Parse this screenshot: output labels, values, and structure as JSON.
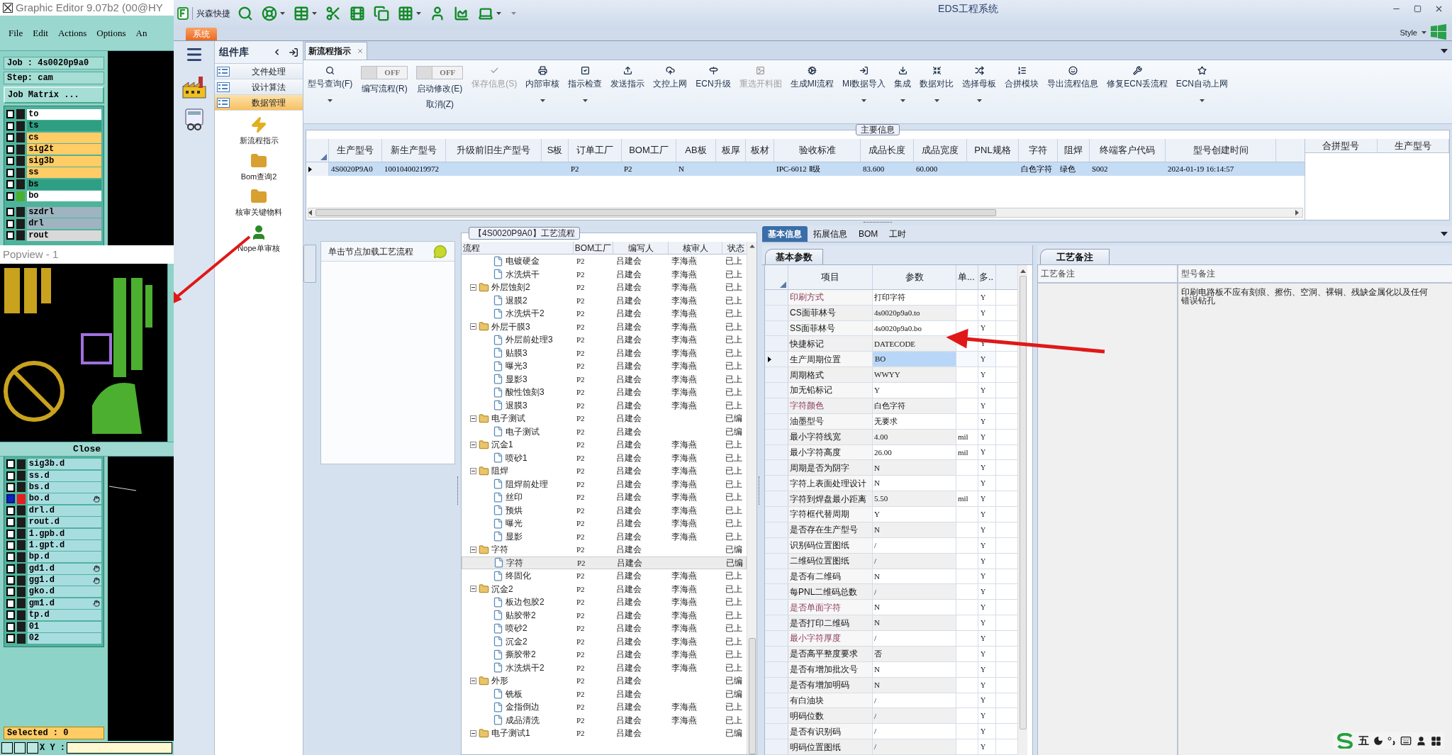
{
  "editor": {
    "title": "Graphic Editor 9.07b2 (00@HY",
    "menu": [
      "File",
      "Edit",
      "Actions",
      "Options",
      "An"
    ],
    "job": "Job : 4s0020p9a0",
    "step": "Step: cam",
    "matrix_button": "Job Matrix ...",
    "layer_groups": [
      {
        "layers": [
          {
            "name": "to",
            "color": "#ffffff",
            "shown": false,
            "checked": false
          },
          {
            "name": "ts",
            "color": "#2f9f83",
            "shown": false,
            "checked": false
          },
          {
            "name": "cs",
            "color": "#ffcc66",
            "shown": false,
            "checked": false
          },
          {
            "name": "sig2t",
            "color": "#ffcc66",
            "shown": false,
            "checked": false
          },
          {
            "name": "sig3b",
            "color": "#ffcc66",
            "shown": false,
            "checked": false
          },
          {
            "name": "ss",
            "color": "#ffcc66",
            "shown": false,
            "checked": false
          },
          {
            "name": "bs",
            "color": "#2f9f83",
            "shown": false,
            "checked": false
          },
          {
            "name": "bo",
            "color": "#ffffff",
            "shown": true,
            "checked": false
          }
        ]
      },
      {
        "layers": [
          {
            "name": "szdrl",
            "color": "#9fb4c0",
            "shown": false,
            "checked": false
          },
          {
            "name": "drl",
            "color": "#9fb4c0",
            "shown": false,
            "checked": false
          },
          {
            "name": "rout",
            "color": "#d9d9d9",
            "shown": false,
            "checked": false
          }
        ]
      }
    ],
    "popview": {
      "title": "Popview - 1",
      "close": "Close"
    },
    "lower_layers": [
      {
        "name": "sig3b.d",
        "work": false,
        "hand": false
      },
      {
        "name": "ss.d",
        "work": false,
        "hand": false
      },
      {
        "name": "bs.d",
        "work": false,
        "hand": false
      },
      {
        "name": "bo.d",
        "work": true,
        "hand": true
      },
      {
        "name": "drl.d",
        "work": false,
        "hand": false
      },
      {
        "name": "rout.d",
        "work": false,
        "hand": false
      },
      {
        "name": "1.gpb.d",
        "work": false,
        "hand": false
      },
      {
        "name": "1.gpt.d",
        "work": false,
        "hand": false
      },
      {
        "name": "bp.d",
        "work": false,
        "hand": false
      },
      {
        "name": "gd1.d",
        "work": false,
        "hand": true
      },
      {
        "name": "gg1.d",
        "work": false,
        "hand": true
      },
      {
        "name": "gko.d",
        "work": false,
        "hand": false
      },
      {
        "name": "gm1.d",
        "work": false,
        "hand": true
      },
      {
        "name": "tp.d",
        "work": false,
        "hand": false
      },
      {
        "name": "01",
        "work": false,
        "hand": false
      },
      {
        "name": "02",
        "work": false,
        "hand": false
      }
    ],
    "selected": "Selected : 0",
    "coords": "X Y :"
  },
  "app": {
    "quick_label": "兴森快捷",
    "title": "EDS工程系统",
    "menu_tab": "系统",
    "style": "Style"
  },
  "components": {
    "title": "组件库",
    "groups": [
      {
        "label": "文件处理",
        "selected": false
      },
      {
        "label": "设计算法",
        "selected": false
      },
      {
        "label": "数据管理",
        "selected": true
      }
    ],
    "tools": [
      "新流程指示",
      "Bom查询2",
      "核审关键物料",
      "Nope单审核"
    ]
  },
  "document_tab": {
    "label": "新流程指示"
  },
  "ribbon": {
    "items": [
      {
        "kind": "button",
        "label": "型号查询(F)",
        "dropdown": true,
        "disabled": false
      },
      {
        "kind": "toggle",
        "state_label": "OFF",
        "on": false,
        "labels": [
          "编写流程(R)"
        ]
      },
      {
        "kind": "toggle",
        "state_label": "OFF",
        "on": false,
        "labels": [
          "启动修改(E)",
          "取消(Z)"
        ]
      },
      {
        "kind": "button",
        "label": "保存信息(S)",
        "dropdown": false,
        "disabled": true
      },
      {
        "kind": "button",
        "label": "内部审核",
        "dropdown": true,
        "disabled": false
      },
      {
        "kind": "button",
        "label": "指示检查",
        "dropdown": true,
        "disabled": false
      },
      {
        "kind": "button",
        "label": "发送指示",
        "dropdown": false,
        "disabled": false
      },
      {
        "kind": "button",
        "label": "文控上网",
        "dropdown": false,
        "disabled": false
      },
      {
        "kind": "button",
        "label": "ECN升级",
        "dropdown": false,
        "disabled": false
      },
      {
        "kind": "button",
        "label": "重选开料图",
        "dropdown": false,
        "disabled": true
      },
      {
        "kind": "button",
        "label": "生成MI流程",
        "dropdown": false,
        "disabled": false
      },
      {
        "kind": "button",
        "label": "MI数据导入",
        "dropdown": true,
        "disabled": false
      },
      {
        "kind": "button",
        "label": "集成",
        "dropdown": true,
        "disabled": false
      },
      {
        "kind": "button",
        "label": "数据对比",
        "dropdown": true,
        "disabled": false
      },
      {
        "kind": "button",
        "label": "选择母板",
        "dropdown": true,
        "disabled": false
      },
      {
        "kind": "button",
        "label": "合拼模块",
        "dropdown": false,
        "disabled": false
      },
      {
        "kind": "button",
        "label": "导出流程信息",
        "dropdown": false,
        "disabled": false
      },
      {
        "kind": "button",
        "label": "修复ECN丢流程",
        "dropdown": false,
        "disabled": false
      },
      {
        "kind": "button",
        "label": "ECN自动上网",
        "dropdown": true,
        "disabled": false
      }
    ]
  },
  "main_info": {
    "legend": "主要信息",
    "columns": [
      "生产型号",
      "新生产型号",
      "升级前旧生产型号",
      "S板",
      "订单工厂",
      "BOM工厂",
      "AB板",
      "板厚",
      "板材",
      "验收标准",
      "成品长度",
      "成品宽度",
      "PNL规格",
      "字符",
      "阻焊",
      "终端客户代码",
      "型号创建时间"
    ],
    "rows": [
      {
        "selected": true,
        "cells": [
          "4S0020P9A0",
          "10010400219972",
          null,
          null,
          "P2",
          "P2",
          "N",
          null,
          null,
          "IPC-6012 Ⅱ级",
          "83.600",
          "60.000",
          null,
          "白色字符",
          "绿色",
          "S002",
          "2024-01-19 16:14:57"
        ]
      }
    ],
    "side_columns": [
      "合拼型号",
      "生产型号"
    ]
  },
  "process": {
    "hint": "单击节点加载工艺流程",
    "legend": "【4S0020P9A0】工艺流程",
    "columns": [
      "流程",
      "BOM工厂",
      "编写人",
      "核审人",
      "状态"
    ],
    "items": [
      {
        "kind": "continued",
        "children": [
          {
            "kind": "file",
            "name": "电镀硬金",
            "bom": "P2",
            "writer": "吕建会",
            "reviewer": "李海燕",
            "status": "已上",
            "selected": false
          },
          {
            "kind": "file",
            "name": "水洗烘干",
            "bom": "P2",
            "writer": "吕建会",
            "reviewer": "李海燕",
            "status": "已上",
            "selected": false
          }
        ]
      },
      {
        "kind": "folder",
        "name": "外层蚀刻2",
        "bom": "P2",
        "writer": "吕建会",
        "reviewer": "李海燕",
        "status": "已上",
        "selected": false,
        "expanded": true,
        "children": [
          {
            "kind": "file",
            "name": "退膜2",
            "bom": "P2",
            "writer": "吕建会",
            "reviewer": "李海燕",
            "status": "已上",
            "selected": false
          },
          {
            "kind": "file",
            "name": "水洗烘干2",
            "bom": "P2",
            "writer": "吕建会",
            "reviewer": "李海燕",
            "status": "已上",
            "selected": false
          }
        ]
      },
      {
        "kind": "folder",
        "name": "外层干膜3",
        "bom": "P2",
        "writer": "吕建会",
        "reviewer": "李海燕",
        "status": "已上",
        "selected": false,
        "expanded": true,
        "children": [
          {
            "kind": "file",
            "name": "外层前处理3",
            "bom": "P2",
            "writer": "吕建会",
            "reviewer": "李海燕",
            "status": "已上",
            "selected": false
          },
          {
            "kind": "file",
            "name": "贴膜3",
            "bom": "P2",
            "writer": "吕建会",
            "reviewer": "李海燕",
            "status": "已上",
            "selected": false
          },
          {
            "kind": "file",
            "name": "曝光3",
            "bom": "P2",
            "writer": "吕建会",
            "reviewer": "李海燕",
            "status": "已上",
            "selected": false
          },
          {
            "kind": "file",
            "name": "显影3",
            "bom": "P2",
            "writer": "吕建会",
            "reviewer": "李海燕",
            "status": "已上",
            "selected": false
          },
          {
            "kind": "file",
            "name": "酸性蚀刻3",
            "bom": "P2",
            "writer": "吕建会",
            "reviewer": "李海燕",
            "status": "已上",
            "selected": false
          },
          {
            "kind": "file",
            "name": "退膜3",
            "bom": "P2",
            "writer": "吕建会",
            "reviewer": "李海燕",
            "status": "已上",
            "selected": false
          }
        ]
      },
      {
        "kind": "folder",
        "name": "电子测试",
        "bom": "P2",
        "writer": "吕建会",
        "status": "已编",
        "selected": false,
        "expanded": true,
        "children": [
          {
            "kind": "file",
            "name": "电子测试",
            "bom": "P2",
            "writer": "吕建会",
            "status": "已编",
            "selected": false
          }
        ]
      },
      {
        "kind": "folder",
        "name": "沉金1",
        "bom": "P2",
        "writer": "吕建会",
        "reviewer": "李海燕",
        "status": "已上",
        "selected": false,
        "expanded": true,
        "children": [
          {
            "kind": "file",
            "name": "喷砂1",
            "bom": "P2",
            "writer": "吕建会",
            "reviewer": "李海燕",
            "status": "已上",
            "selected": false
          }
        ]
      },
      {
        "kind": "folder",
        "name": "阻焊",
        "bom": "P2",
        "writer": "吕建会",
        "reviewer": "李海燕",
        "status": "已上",
        "selected": false,
        "expanded": true,
        "children": [
          {
            "kind": "file",
            "name": "阻焊前处理",
            "bom": "P2",
            "writer": "吕建会",
            "reviewer": "李海燕",
            "status": "已上",
            "selected": false
          },
          {
            "kind": "file",
            "name": "丝印",
            "bom": "P2",
            "writer": "吕建会",
            "reviewer": "李海燕",
            "status": "已上",
            "selected": false
          },
          {
            "kind": "file",
            "name": "预烘",
            "bom": "P2",
            "writer": "吕建会",
            "reviewer": "李海燕",
            "status": "已上",
            "selected": false
          },
          {
            "kind": "file",
            "name": "曝光",
            "bom": "P2",
            "writer": "吕建会",
            "reviewer": "李海燕",
            "status": "已上",
            "selected": false
          },
          {
            "kind": "file",
            "name": "显影",
            "bom": "P2",
            "writer": "吕建会",
            "reviewer": "李海燕",
            "status": "已上",
            "selected": false
          }
        ]
      },
      {
        "kind": "folder",
        "name": "字符",
        "bom": "P2",
        "writer": "吕建会",
        "status": "已编",
        "selected": false,
        "expanded": true,
        "children": [
          {
            "kind": "file",
            "name": "字符",
            "bom": "P2",
            "writer": "吕建会",
            "status": "已编",
            "selected": true
          },
          {
            "kind": "file",
            "name": "终固化",
            "bom": "P2",
            "writer": "吕建会",
            "reviewer": "李海燕",
            "status": "已上",
            "selected": false
          }
        ]
      },
      {
        "kind": "folder",
        "name": "沉金2",
        "bom": "P2",
        "writer": "吕建会",
        "reviewer": "李海燕",
        "status": "已上",
        "selected": false,
        "expanded": true,
        "children": [
          {
            "kind": "file",
            "name": "板边包胶2",
            "bom": "P2",
            "writer": "吕建会",
            "reviewer": "李海燕",
            "status": "已上",
            "selected": false
          },
          {
            "kind": "file",
            "name": "贴胶带2",
            "bom": "P2",
            "writer": "吕建会",
            "reviewer": "李海燕",
            "status": "已上",
            "selected": false
          },
          {
            "kind": "file",
            "name": "喷砂2",
            "bom": "P2",
            "writer": "吕建会",
            "reviewer": "李海燕",
            "status": "已上",
            "selected": false
          },
          {
            "kind": "file",
            "name": "沉金2",
            "bom": "P2",
            "writer": "吕建会",
            "reviewer": "李海燕",
            "status": "已上",
            "selected": false
          },
          {
            "kind": "file",
            "name": "撕胶带2",
            "bom": "P2",
            "writer": "吕建会",
            "reviewer": "李海燕",
            "status": "已上",
            "selected": false
          },
          {
            "kind": "file",
            "name": "水洗烘干2",
            "bom": "P2",
            "writer": "吕建会",
            "reviewer": "李海燕",
            "status": "已上",
            "selected": false
          }
        ]
      },
      {
        "kind": "folder",
        "name": "外形",
        "bom": "P2",
        "writer": "吕建会",
        "status": "已编",
        "selected": false,
        "expanded": true,
        "children": [
          {
            "kind": "file",
            "name": "铣板",
            "bom": "P2",
            "writer": "吕建会",
            "status": "已编",
            "selected": false
          },
          {
            "kind": "file",
            "name": "金指倒边",
            "bom": "P2",
            "writer": "吕建会",
            "reviewer": "李海燕",
            "status": "已上",
            "selected": false
          },
          {
            "kind": "file",
            "name": "成品清洗",
            "bom": "P2",
            "writer": "吕建会",
            "reviewer": "李海燕",
            "status": "已上",
            "selected": false
          }
        ]
      },
      {
        "kind": "folder",
        "name": "电子测试1",
        "bom": "P2",
        "writer": "吕建会",
        "status": "已编",
        "selected": false,
        "expanded": true
      }
    ]
  },
  "detail": {
    "tabs": [
      {
        "label": "基本信息",
        "selected": true
      },
      {
        "label": "拓展信息",
        "selected": false
      },
      {
        "label": "BOM",
        "selected": false
      },
      {
        "label": "工时",
        "selected": false
      }
    ],
    "params": {
      "tab": "基本参数",
      "columns": [
        "项目",
        "参数",
        "单...",
        "多.."
      ],
      "rows": [
        {
          "item": "印刷方式",
          "value": "打印字符",
          "flag": "Y",
          "emphasized": true,
          "selected": false
        },
        {
          "item": "CS面菲林号",
          "value": "4s0020p9a0.to",
          "flag": "Y",
          "emphasized": false,
          "selected": false
        },
        {
          "item": "SS面菲林号",
          "value": "4s0020p9a0.bo",
          "flag": "Y",
          "emphasized": false,
          "selected": false
        },
        {
          "item": "快捷标记",
          "value": "DATECODE",
          "flag": "Y",
          "emphasized": false,
          "selected": false
        },
        {
          "item": "生产周期位置",
          "value": "BO",
          "flag": "Y",
          "emphasized": false,
          "selected": true
        },
        {
          "item": "周期格式",
          "value": "WWYY",
          "flag": "Y",
          "emphasized": false,
          "selected": false
        },
        {
          "item": "加无铅标记",
          "value": "Y",
          "flag": "Y",
          "emphasized": false,
          "selected": false
        },
        {
          "item": "字符颜色",
          "value": "白色字符",
          "flag": "Y",
          "emphasized": true,
          "selected": false
        },
        {
          "item": "油墨型号",
          "value": "无要求",
          "flag": "Y",
          "emphasized": false,
          "selected": false
        },
        {
          "item": "最小字符线宽",
          "value": "4.00",
          "unit": "mil",
          "flag": "Y",
          "emphasized": false,
          "selected": false
        },
        {
          "item": "最小字符高度",
          "value": "26.00",
          "unit": "mil",
          "flag": "Y",
          "emphasized": false,
          "selected": false
        },
        {
          "item": "周期是否为阴字",
          "value": "N",
          "flag": "Y",
          "emphasized": false,
          "selected": false
        },
        {
          "item": "字符上表面处理设计",
          "value": "N",
          "flag": "Y",
          "emphasized": false,
          "selected": false
        },
        {
          "item": "字符到焊盘最小距离",
          "value": "5.50",
          "unit": "mil",
          "flag": "Y",
          "emphasized": false,
          "selected": false
        },
        {
          "item": "字符框代替周期",
          "value": "Y",
          "flag": "Y",
          "emphasized": false,
          "selected": false
        },
        {
          "item": "是否存在生产型号",
          "value": "N",
          "flag": "Y",
          "emphasized": false,
          "selected": false
        },
        {
          "item": "识别码位置图纸",
          "value": "/",
          "flag": "Y",
          "emphasized": false,
          "selected": false
        },
        {
          "item": "二维码位置图纸",
          "value": "/",
          "flag": "Y",
          "emphasized": false,
          "selected": false
        },
        {
          "item": "是否有二维码",
          "value": "N",
          "flag": "Y",
          "emphasized": false,
          "selected": false
        },
        {
          "item": "每PNL二维码总数",
          "value": "/",
          "flag": "Y",
          "emphasized": false,
          "selected": false
        },
        {
          "item": "是否单面字符",
          "value": "N",
          "flag": "Y",
          "emphasized": true,
          "selected": false
        },
        {
          "item": "是否打印二维码",
          "value": "N",
          "flag": "Y",
          "emphasized": false,
          "selected": false
        },
        {
          "item": "最小字符厚度",
          "value": "/",
          "flag": "Y",
          "emphasized": true,
          "selected": false
        },
        {
          "item": "是否高平整度要求",
          "value": "否",
          "flag": "Y",
          "emphasized": false,
          "selected": false
        },
        {
          "item": "是否有增加批次号",
          "value": "N",
          "flag": "Y",
          "emphasized": false,
          "selected": false
        },
        {
          "item": "是否有增加明码",
          "value": "N",
          "flag": "Y",
          "emphasized": false,
          "selected": false
        },
        {
          "item": "有白油块",
          "value": "/",
          "flag": "Y",
          "emphasized": false,
          "selected": false
        },
        {
          "item": "明码位数",
          "value": "/",
          "flag": "Y",
          "emphasized": false,
          "selected": false
        },
        {
          "item": "是否有识别码",
          "value": "/",
          "flag": "Y",
          "emphasized": false,
          "selected": false
        },
        {
          "item": "明码位置图纸",
          "value": "/",
          "flag": "Y",
          "emphasized": false,
          "selected": false
        }
      ]
    },
    "remarks": {
      "tab": "工艺备注",
      "columns": [
        "工艺备注",
        "型号备注"
      ],
      "note": "印刷电路板不应有刻痕、擦伤、空洞、裸铜、残缺金属化以及任何错误钻孔"
    }
  },
  "ime": {
    "label": "五"
  }
}
